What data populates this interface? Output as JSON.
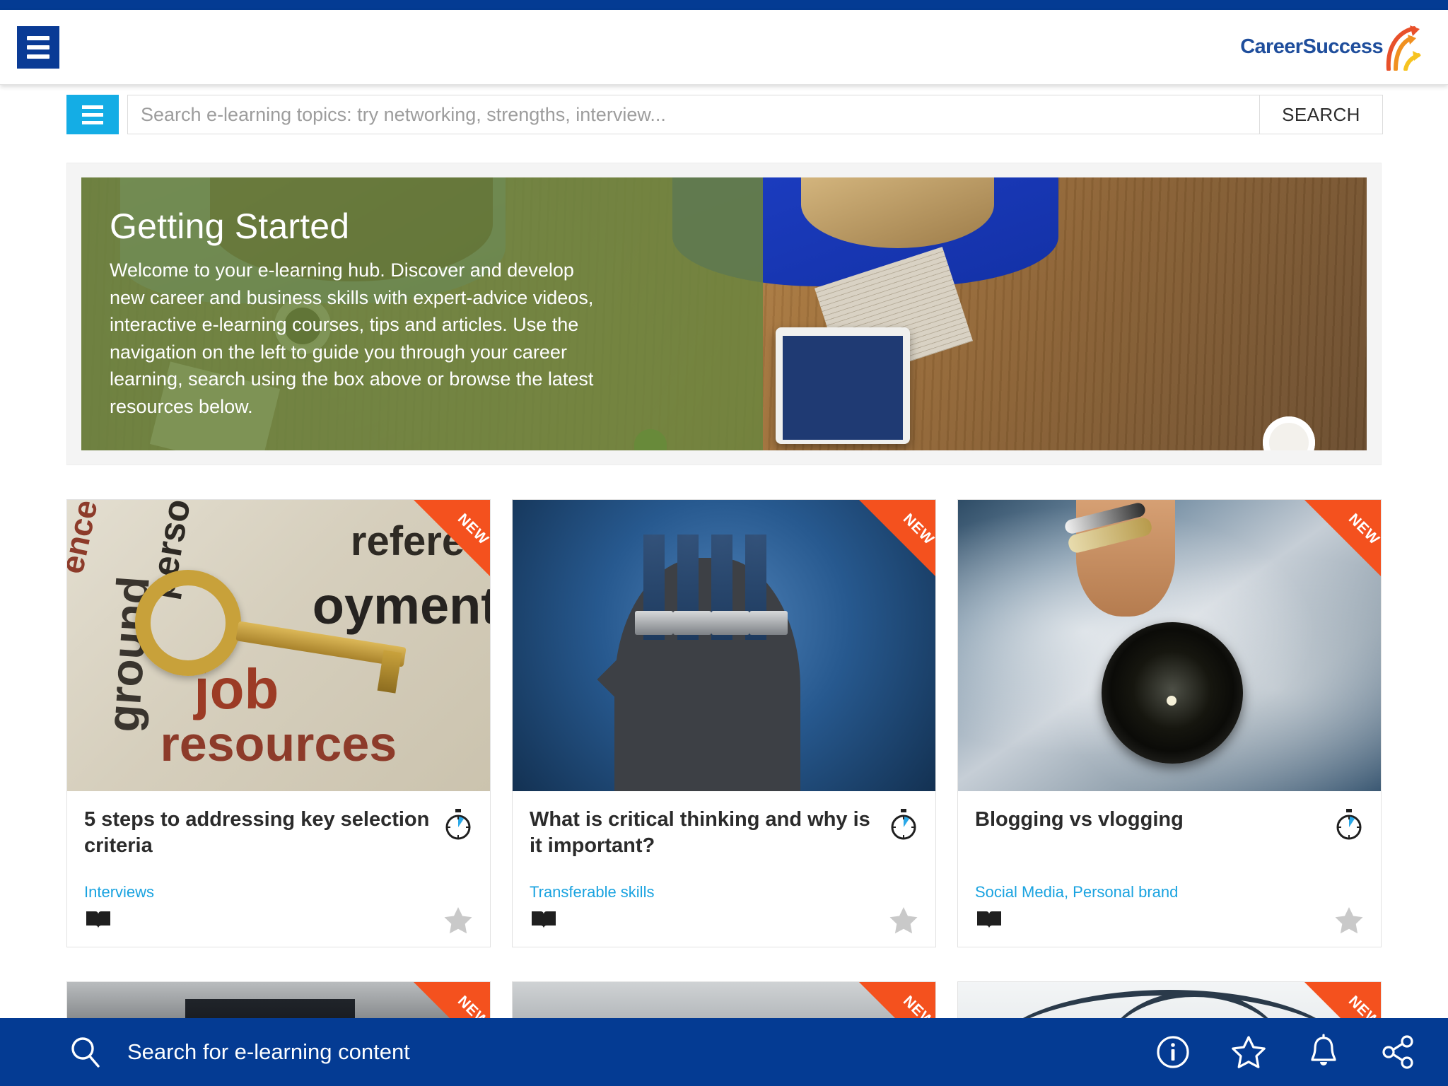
{
  "header": {
    "menu_icon": "hamburger-icon",
    "brand_name": "CareerSuccess",
    "brand_mark_icon": "arrows-upward-icon"
  },
  "search": {
    "menu_icon": "hamburger-icon",
    "placeholder": "Search e-learning topics: try networking, strengths, interview...",
    "value": "",
    "button_label": "SEARCH"
  },
  "hero": {
    "title": "Getting Started",
    "body": "Welcome to your e-learning hub. Discover and develop new career and business skills with expert-advice videos, interactive e-learning courses, tips and articles. Use the navigation on the left to guide you through your career learning, search using the box above or browse the latest resources below."
  },
  "cards": [
    {
      "badge": "NEW",
      "title": "5 steps to addressing key selection criteria",
      "tags": "Interviews",
      "duration_icon": "stopwatch-icon",
      "format_icon": "open-book-icon",
      "favourite_icon": "star-icon",
      "image_alt": "gold key on printed job resources words"
    },
    {
      "badge": "NEW",
      "title": "What is critical thinking and why is it important?",
      "tags": "Transferable skills",
      "duration_icon": "stopwatch-icon",
      "format_icon": "open-book-icon",
      "favourite_icon": "star-icon",
      "image_alt": "head silhouette with piano keys"
    },
    {
      "badge": "NEW",
      "title": "Blogging vs vlogging",
      "tags": "Social Media, Personal brand",
      "duration_icon": "stopwatch-icon",
      "format_icon": "open-book-icon",
      "favourite_icon": "star-icon",
      "image_alt": "hand holding camera lens"
    }
  ],
  "cards_row2": [
    {
      "badge": "NEW"
    },
    {
      "badge": "NEW"
    },
    {
      "badge": "NEW"
    }
  ],
  "bottom_bar": {
    "search_icon": "magnifier-icon",
    "search_label": "Search for e-learning content",
    "icons": [
      {
        "name": "info-icon"
      },
      {
        "name": "star-icon"
      },
      {
        "name": "bell-icon"
      },
      {
        "name": "share-icon"
      }
    ]
  },
  "colors": {
    "brand_blue": "#043b93",
    "accent_cyan": "#14ade5",
    "hero_green": "#6c843e",
    "ribbon_orange": "#f4511e",
    "link_blue": "#1aa3e0"
  }
}
